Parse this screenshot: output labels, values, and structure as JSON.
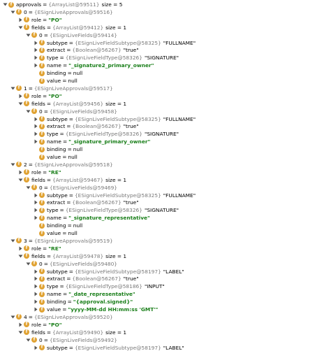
{
  "colors": {
    "field_icon": "#e0a232",
    "string_value": "#1a7f1a",
    "type_text": "#7a7a7a",
    "arrow": "#555555"
  },
  "rows": [
    {
      "depth": 0,
      "toggle": "expanded",
      "icon": "field-icon",
      "name": "approvals",
      "type": "{ArrayList@59511}",
      "value": "size = 5",
      "value_kind": "plain"
    },
    {
      "depth": 1,
      "toggle": "expanded",
      "icon": "field-icon",
      "name": "0",
      "type": "{ESignLiveApprovals@59516}",
      "value": "",
      "value_kind": "plain"
    },
    {
      "depth": 2,
      "toggle": "collapsed",
      "icon": "field-icon",
      "name": "role",
      "type": "",
      "value": "\"PO\"",
      "value_kind": "string"
    },
    {
      "depth": 2,
      "toggle": "expanded",
      "icon": "field-icon",
      "name": "fields",
      "type": "{ArrayList@59412}",
      "value": "size = 1",
      "value_kind": "plain"
    },
    {
      "depth": 3,
      "toggle": "expanded",
      "icon": "field-icon",
      "name": "0",
      "type": "{ESignLiveFields@59414}",
      "value": "",
      "value_kind": "plain"
    },
    {
      "depth": 4,
      "toggle": "collapsed",
      "icon": "field-icon",
      "name": "subtype",
      "type": "{ESignLiveFieldSubtype@58325}",
      "value": "\"FULLNAME\"",
      "value_kind": "plain"
    },
    {
      "depth": 4,
      "toggle": "collapsed",
      "icon": "field-icon",
      "name": "extract",
      "type": "{Boolean@56267}",
      "value": "\"true\"",
      "value_kind": "plain"
    },
    {
      "depth": 4,
      "toggle": "collapsed",
      "icon": "field-icon",
      "name": "type",
      "type": "{ESignLiveFieldType@58326}",
      "value": "\"SIGNATURE\"",
      "value_kind": "plain"
    },
    {
      "depth": 4,
      "toggle": "collapsed",
      "icon": "field-icon",
      "name": "name",
      "type": "",
      "value": "\"_signature2_primary_owner\"",
      "value_kind": "string"
    },
    {
      "depth": 4,
      "toggle": "none",
      "icon": "field-icon",
      "name": "binding",
      "type": "",
      "value": "null",
      "value_kind": "plain"
    },
    {
      "depth": 4,
      "toggle": "none",
      "icon": "field-icon",
      "name": "value",
      "type": "",
      "value": "null",
      "value_kind": "plain"
    },
    {
      "depth": 1,
      "toggle": "expanded",
      "icon": "field-icon",
      "name": "1",
      "type": "{ESignLiveApprovals@59517}",
      "value": "",
      "value_kind": "plain"
    },
    {
      "depth": 2,
      "toggle": "collapsed",
      "icon": "field-icon",
      "name": "role",
      "type": "",
      "value": "\"PO\"",
      "value_kind": "string"
    },
    {
      "depth": 2,
      "toggle": "expanded",
      "icon": "field-icon",
      "name": "fields",
      "type": "{ArrayList@59456}",
      "value": "size = 1",
      "value_kind": "plain"
    },
    {
      "depth": 3,
      "toggle": "expanded",
      "icon": "field-icon",
      "name": "0",
      "type": "{ESignLiveFields@59458}",
      "value": "",
      "value_kind": "plain"
    },
    {
      "depth": 4,
      "toggle": "collapsed",
      "icon": "field-icon",
      "name": "subtype",
      "type": "{ESignLiveFieldSubtype@58325}",
      "value": "\"FULLNAME\"",
      "value_kind": "plain"
    },
    {
      "depth": 4,
      "toggle": "collapsed",
      "icon": "field-icon",
      "name": "extract",
      "type": "{Boolean@56267}",
      "value": "\"true\"",
      "value_kind": "plain"
    },
    {
      "depth": 4,
      "toggle": "collapsed",
      "icon": "field-icon",
      "name": "type",
      "type": "{ESignLiveFieldType@58326}",
      "value": "\"SIGNATURE\"",
      "value_kind": "plain"
    },
    {
      "depth": 4,
      "toggle": "collapsed",
      "icon": "field-icon",
      "name": "name",
      "type": "",
      "value": "\"_signature_primary_owner\"",
      "value_kind": "string"
    },
    {
      "depth": 4,
      "toggle": "none",
      "icon": "field-icon",
      "name": "binding",
      "type": "",
      "value": "null",
      "value_kind": "plain"
    },
    {
      "depth": 4,
      "toggle": "none",
      "icon": "field-icon",
      "name": "value",
      "type": "",
      "value": "null",
      "value_kind": "plain"
    },
    {
      "depth": 1,
      "toggle": "expanded",
      "icon": "field-icon",
      "name": "2",
      "type": "{ESignLiveApprovals@59518}",
      "value": "",
      "value_kind": "plain"
    },
    {
      "depth": 2,
      "toggle": "collapsed",
      "icon": "field-icon",
      "name": "role",
      "type": "",
      "value": "\"RE\"",
      "value_kind": "string"
    },
    {
      "depth": 2,
      "toggle": "expanded",
      "icon": "field-icon",
      "name": "fields",
      "type": "{ArrayList@59467}",
      "value": "size = 1",
      "value_kind": "plain"
    },
    {
      "depth": 3,
      "toggle": "expanded",
      "icon": "field-icon",
      "name": "0",
      "type": "{ESignLiveFields@59469}",
      "value": "",
      "value_kind": "plain"
    },
    {
      "depth": 4,
      "toggle": "collapsed",
      "icon": "field-icon",
      "name": "subtype",
      "type": "{ESignLiveFieldSubtype@58325}",
      "value": "\"FULLNAME\"",
      "value_kind": "plain"
    },
    {
      "depth": 4,
      "toggle": "collapsed",
      "icon": "field-icon",
      "name": "extract",
      "type": "{Boolean@56267}",
      "value": "\"true\"",
      "value_kind": "plain"
    },
    {
      "depth": 4,
      "toggle": "collapsed",
      "icon": "field-icon",
      "name": "type",
      "type": "{ESignLiveFieldType@58326}",
      "value": "\"SIGNATURE\"",
      "value_kind": "plain"
    },
    {
      "depth": 4,
      "toggle": "collapsed",
      "icon": "field-icon",
      "name": "name",
      "type": "",
      "value": "\"_signature_representative\"",
      "value_kind": "string"
    },
    {
      "depth": 4,
      "toggle": "none",
      "icon": "field-icon",
      "name": "binding",
      "type": "",
      "value": "null",
      "value_kind": "plain"
    },
    {
      "depth": 4,
      "toggle": "none",
      "icon": "field-icon",
      "name": "value",
      "type": "",
      "value": "null",
      "value_kind": "plain"
    },
    {
      "depth": 1,
      "toggle": "expanded",
      "icon": "field-icon",
      "name": "3",
      "type": "{ESignLiveApprovals@59519}",
      "value": "",
      "value_kind": "plain"
    },
    {
      "depth": 2,
      "toggle": "collapsed",
      "icon": "field-icon",
      "name": "role",
      "type": "",
      "value": "\"RE\"",
      "value_kind": "string"
    },
    {
      "depth": 2,
      "toggle": "expanded",
      "icon": "field-icon",
      "name": "fields",
      "type": "{ArrayList@59478}",
      "value": "size = 1",
      "value_kind": "plain"
    },
    {
      "depth": 3,
      "toggle": "expanded",
      "icon": "field-icon",
      "name": "0",
      "type": "{ESignLiveFields@59480}",
      "value": "",
      "value_kind": "plain"
    },
    {
      "depth": 4,
      "toggle": "collapsed",
      "icon": "field-icon",
      "name": "subtype",
      "type": "{ESignLiveFieldSubtype@58197}",
      "value": "\"LABEL\"",
      "value_kind": "plain"
    },
    {
      "depth": 4,
      "toggle": "collapsed",
      "icon": "field-icon",
      "name": "extract",
      "type": "{Boolean@56267}",
      "value": "\"true\"",
      "value_kind": "plain"
    },
    {
      "depth": 4,
      "toggle": "collapsed",
      "icon": "field-icon",
      "name": "type",
      "type": "{ESignLiveFieldType@58186}",
      "value": "\"INPUT\"",
      "value_kind": "plain"
    },
    {
      "depth": 4,
      "toggle": "collapsed",
      "icon": "field-icon",
      "name": "name",
      "type": "",
      "value": "\"_date_representative\"",
      "value_kind": "string"
    },
    {
      "depth": 4,
      "toggle": "collapsed",
      "icon": "field-icon",
      "name": "binding",
      "type": "",
      "value": "\"{approval.signed}\"",
      "value_kind": "string"
    },
    {
      "depth": 4,
      "toggle": "collapsed",
      "icon": "field-icon",
      "name": "value",
      "type": "",
      "value": "\"yyyy-MM-dd HH:mm:ss 'GMT'\"",
      "value_kind": "string"
    },
    {
      "depth": 1,
      "toggle": "expanded",
      "icon": "field-icon",
      "name": "4",
      "type": "{ESignLiveApprovals@59520}",
      "value": "",
      "value_kind": "plain"
    },
    {
      "depth": 2,
      "toggle": "collapsed",
      "icon": "field-icon",
      "name": "role",
      "type": "",
      "value": "\"PO\"",
      "value_kind": "string"
    },
    {
      "depth": 2,
      "toggle": "expanded",
      "icon": "field-icon",
      "name": "fields",
      "type": "{ArrayList@59490}",
      "value": "size = 1",
      "value_kind": "plain"
    },
    {
      "depth": 3,
      "toggle": "expanded",
      "icon": "field-icon",
      "name": "0",
      "type": "{ESignLiveFields@59492}",
      "value": "",
      "value_kind": "plain"
    },
    {
      "depth": 4,
      "toggle": "collapsed",
      "icon": "field-icon",
      "name": "subtype",
      "type": "{ESignLiveFieldSubtype@58197}",
      "value": "\"LABEL\"",
      "value_kind": "plain"
    }
  ]
}
